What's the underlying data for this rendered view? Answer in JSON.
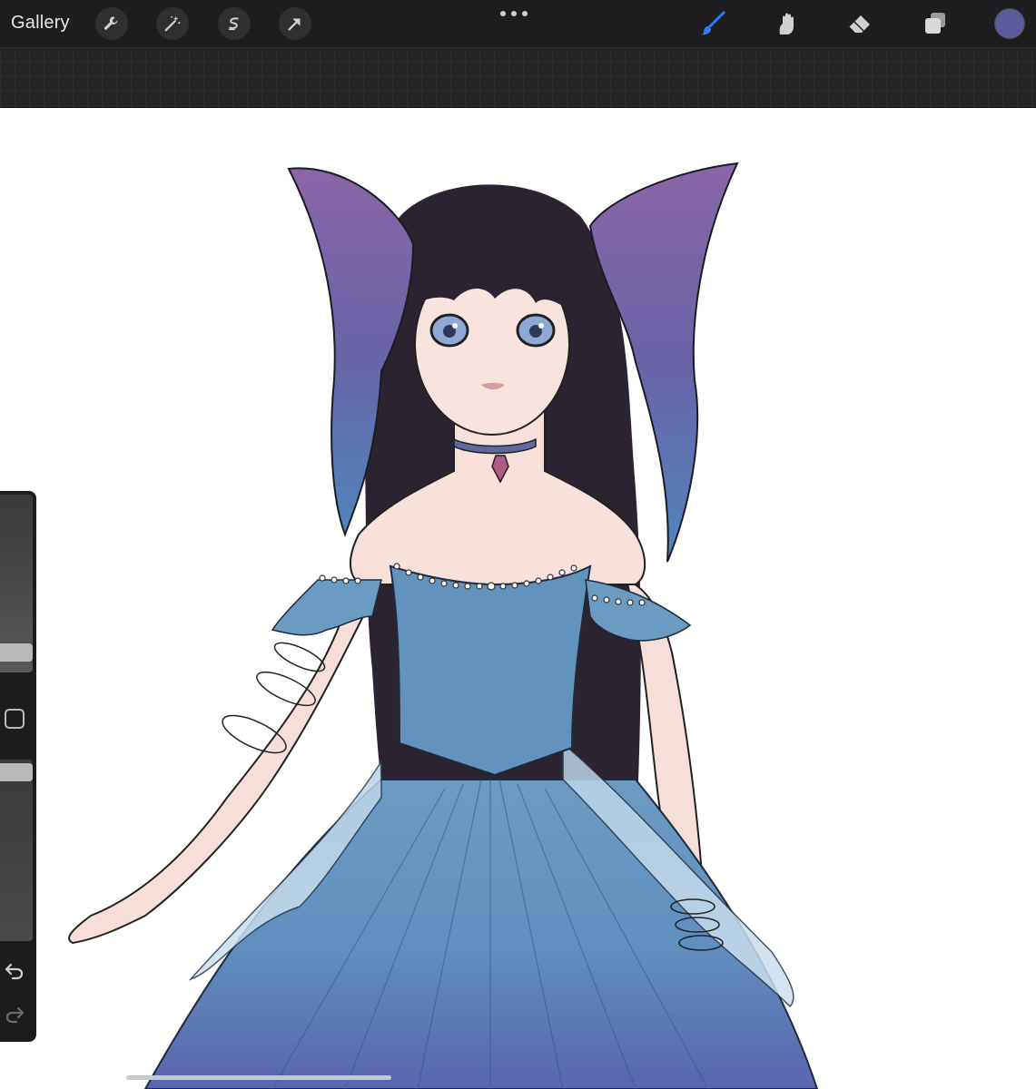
{
  "toolbar": {
    "gallery_label": "Gallery",
    "left_tools": [
      "wrench-icon",
      "magic-wand-icon",
      "selection-icon",
      "transform-arrow-icon"
    ],
    "more_icon": "ellipsis-icon",
    "right_tools": [
      "brush-icon",
      "smudge-icon",
      "eraser-icon",
      "layers-icon"
    ],
    "active_tool": "brush",
    "active_color": "#5b5a9c",
    "brush_accent": "#2f7df6"
  },
  "sidebar": {
    "brush_size_level": 0.3,
    "opacity_level": 0.95,
    "modify_button": "square-icon",
    "undo": "undo-icon",
    "redo": "redo-icon"
  },
  "canvas": {
    "background": "#ffffff",
    "artwork": "illustration"
  }
}
